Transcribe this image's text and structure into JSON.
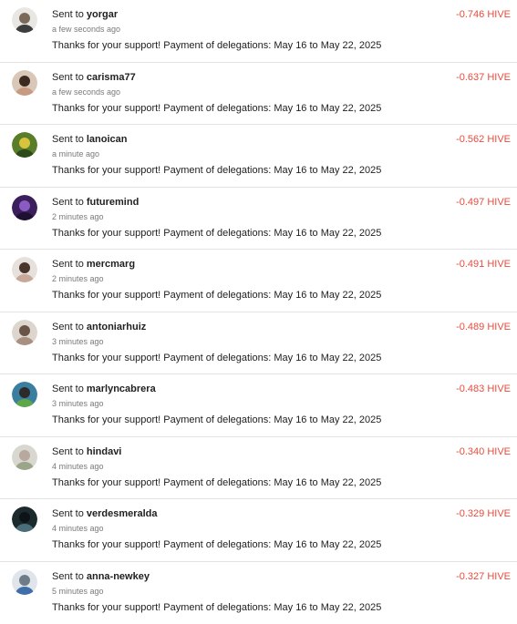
{
  "transfers": [
    {
      "prefix": "Sent to",
      "user": "yorgar",
      "time": "a few seconds ago",
      "memo": "Thanks for your support! Payment of delegations: May 16 to May 22, 2025",
      "amount": "-0.746 HIVE",
      "avatar_icon": "user-avatar-icon",
      "avatar_colors": {
        "bg": "#e9e7e4",
        "head": "#7b6a5a",
        "body": "#3d3d3d"
      }
    },
    {
      "prefix": "Sent to",
      "user": "carisma77",
      "time": "a few seconds ago",
      "memo": "Thanks for your support! Payment of delegations: May 16 to May 22, 2025",
      "amount": "-0.637 HIVE",
      "avatar_icon": "user-avatar-icon",
      "avatar_colors": {
        "bg": "#d9c7b8",
        "head": "#3a2a20",
        "body": "#c79a82"
      }
    },
    {
      "prefix": "Sent to",
      "user": "lanoican",
      "time": "a minute ago",
      "memo": "Thanks for your support! Payment of delegations: May 16 to May 22, 2025",
      "amount": "-0.562 HIVE",
      "avatar_icon": "user-avatar-icon",
      "avatar_colors": {
        "bg": "#5a7d2a",
        "head": "#d9c23c",
        "body": "#2e4a1a"
      }
    },
    {
      "prefix": "Sent to",
      "user": "futuremind",
      "time": "2 minutes ago",
      "memo": "Thanks for your support! Payment of delegations: May 16 to May 22, 2025",
      "amount": "-0.497 HIVE",
      "avatar_icon": "user-avatar-icon",
      "avatar_colors": {
        "bg": "#3a1f5c",
        "head": "#8a5bc2",
        "body": "#1e0f33"
      }
    },
    {
      "prefix": "Sent to",
      "user": "mercmarg",
      "time": "2 minutes ago",
      "memo": "Thanks for your support! Payment of delegations: May 16 to May 22, 2025",
      "amount": "-0.491 HIVE",
      "avatar_icon": "user-avatar-icon",
      "avatar_colors": {
        "bg": "#e6e1dc",
        "head": "#4a352b",
        "body": "#c9a89a"
      }
    },
    {
      "prefix": "Sent to",
      "user": "antoniarhuiz",
      "time": "3 minutes ago",
      "memo": "Thanks for your support! Payment of delegations: May 16 to May 22, 2025",
      "amount": "-0.489 HIVE",
      "avatar_icon": "user-avatar-icon",
      "avatar_colors": {
        "bg": "#dcd6cf",
        "head": "#6a5447",
        "body": "#a88f80"
      }
    },
    {
      "prefix": "Sent to",
      "user": "marlyncabrera",
      "time": "3 minutes ago",
      "memo": "Thanks for your support! Payment of delegations: May 16 to May 22, 2025",
      "amount": "-0.483 HIVE",
      "avatar_icon": "user-avatar-icon",
      "avatar_colors": {
        "bg": "#3a7fa0",
        "head": "#2f2a2a",
        "body": "#5ea64a"
      }
    },
    {
      "prefix": "Sent to",
      "user": "hindavi",
      "time": "4 minutes ago",
      "memo": "Thanks for your support! Payment of delegations: May 16 to May 22, 2025",
      "amount": "-0.340 HIVE",
      "avatar_icon": "user-avatar-icon",
      "avatar_colors": {
        "bg": "#d8d8d0",
        "head": "#b7a8a0",
        "body": "#9aa58a"
      }
    },
    {
      "prefix": "Sent to",
      "user": "verdesmeralda",
      "time": "4 minutes ago",
      "memo": "Thanks for your support! Payment of delegations: May 16 to May 22, 2025",
      "amount": "-0.329 HIVE",
      "avatar_icon": "user-avatar-icon",
      "avatar_colors": {
        "bg": "#1c2a2e",
        "head": "#0d1418",
        "body": "#4a6e78"
      }
    },
    {
      "prefix": "Sent to",
      "user": "anna-newkey",
      "time": "5 minutes ago",
      "memo": "Thanks for your support! Payment of delegations: May 16 to May 22, 2025",
      "amount": "-0.327 HIVE",
      "avatar_icon": "user-avatar-icon",
      "avatar_colors": {
        "bg": "#dfe5ea",
        "head": "#6f7c88",
        "body": "#3f6fa8"
      }
    }
  ]
}
